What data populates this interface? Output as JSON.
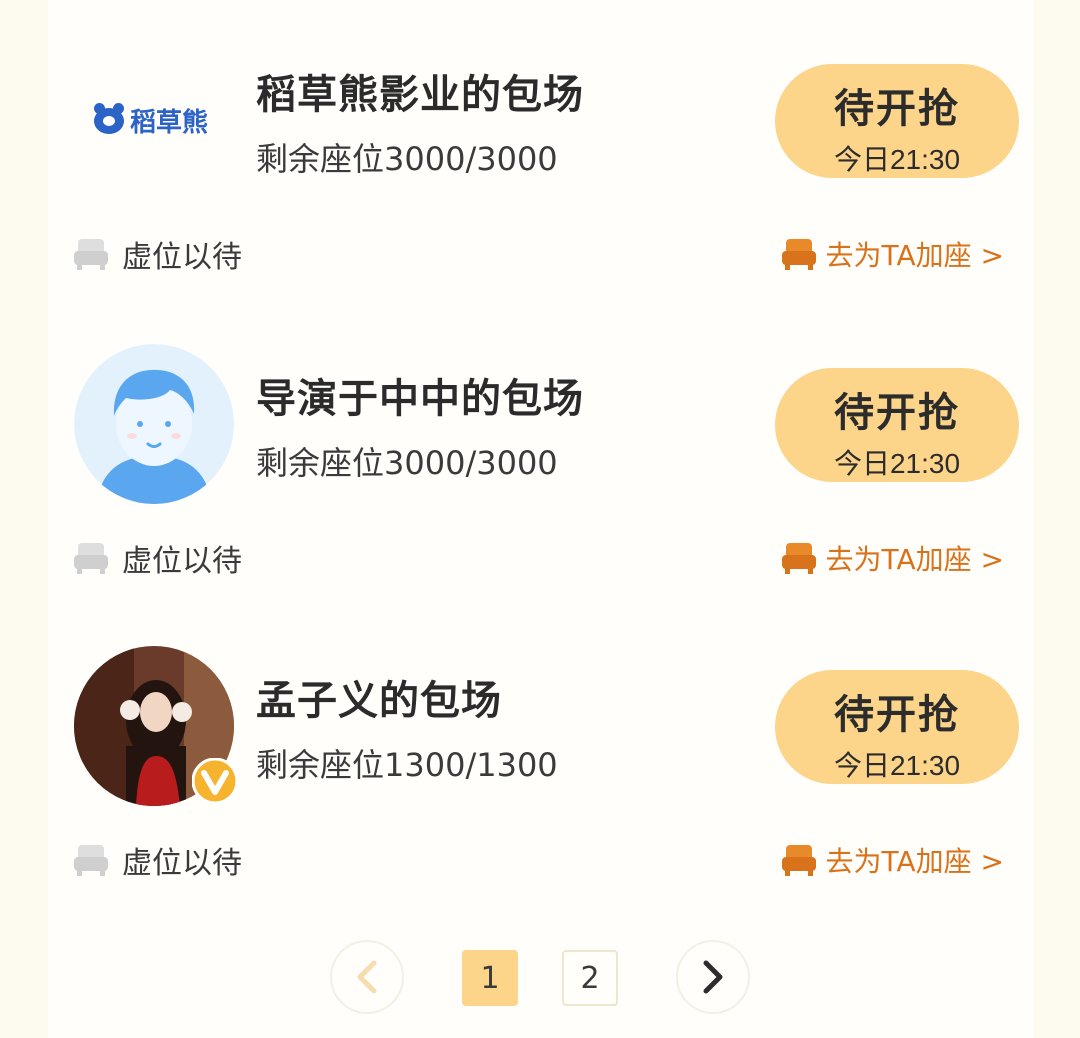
{
  "items": [
    {
      "title": "稻草熊影业的包场",
      "logo_text": "稻草熊",
      "seats": "剩余座位3000/3000",
      "button_main": "待开抢",
      "button_time": "今日21:30",
      "vacant_label": "虚位以待",
      "add_seat_label": "去为TA加座 >"
    },
    {
      "title": "导演于中中的包场",
      "seats": "剩余座位3000/3000",
      "button_main": "待开抢",
      "button_time": "今日21:30",
      "vacant_label": "虚位以待",
      "add_seat_label": "去为TA加座 >"
    },
    {
      "title": "孟子义的包场",
      "seats": "剩余座位1300/1300",
      "button_main": "待开抢",
      "button_time": "今日21:30",
      "vacant_label": "虚位以待",
      "add_seat_label": "去为TA加座 >"
    }
  ],
  "pagination": {
    "prev_icon": "chevron-left-icon",
    "next_icon": "chevron-right-icon",
    "pages": [
      "1",
      "2"
    ],
    "current": "1"
  },
  "colors": {
    "button_bg": "#fcd48a",
    "accent_orange": "#d9731b",
    "logo_blue": "#2b63c6",
    "verified_badge": "#f5b32e"
  }
}
